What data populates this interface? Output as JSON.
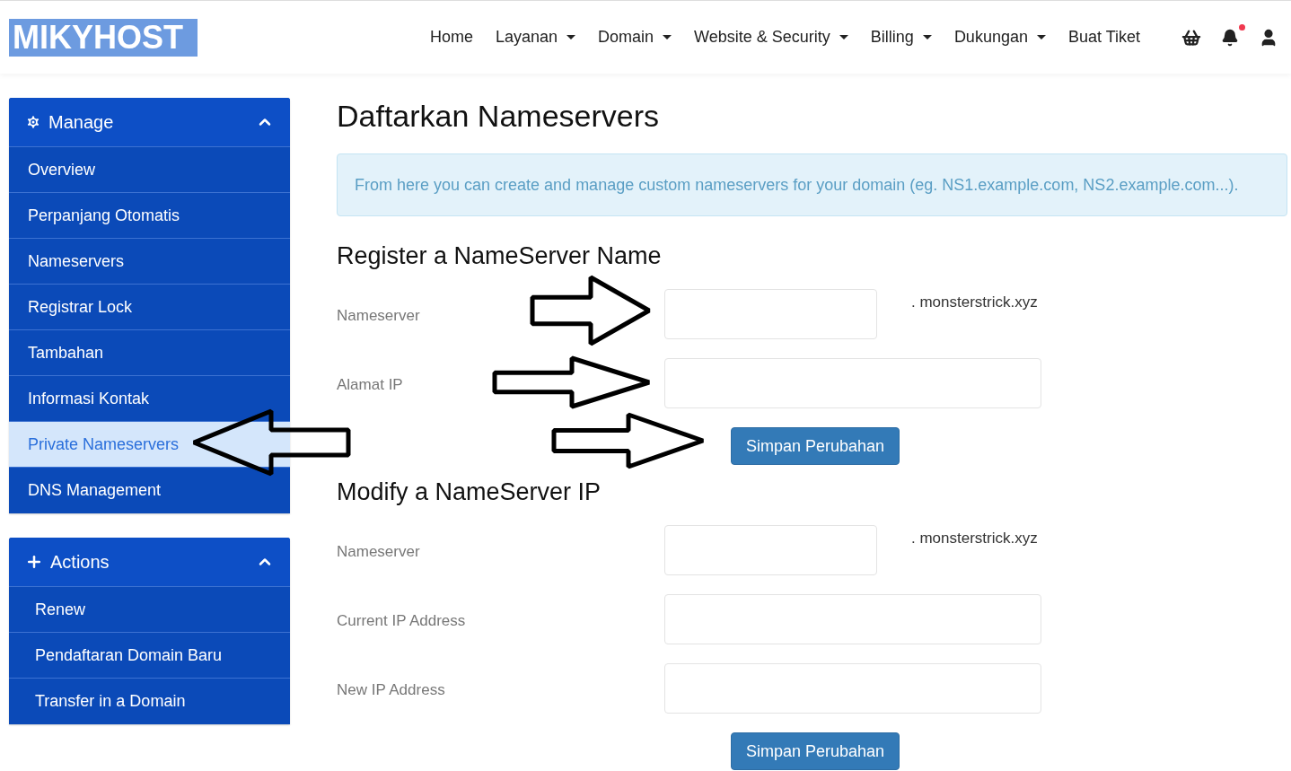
{
  "logo": "MIKYHOST",
  "nav": [
    {
      "label": "Home",
      "dropdown": false
    },
    {
      "label": "Layanan",
      "dropdown": true
    },
    {
      "label": "Domain",
      "dropdown": true
    },
    {
      "label": "Website & Security",
      "dropdown": true
    },
    {
      "label": "Billing",
      "dropdown": true
    },
    {
      "label": "Dukungan",
      "dropdown": true
    },
    {
      "label": "Buat Tiket",
      "dropdown": false
    }
  ],
  "notifications": {
    "unread": true
  },
  "sidebar": [
    {
      "title": "Manage",
      "expanded": true,
      "items": [
        {
          "label": "Overview",
          "selected": false
        },
        {
          "label": "Perpanjang Otomatis",
          "selected": false
        },
        {
          "label": "Nameservers",
          "selected": false
        },
        {
          "label": "Registrar Lock",
          "selected": false
        },
        {
          "label": "Tambahan",
          "selected": false
        },
        {
          "label": "Informasi Kontak",
          "selected": false
        },
        {
          "label": "Private Nameservers",
          "selected": true
        },
        {
          "label": "DNS Management",
          "selected": false
        }
      ]
    },
    {
      "title": "Actions",
      "expanded": true,
      "items": [
        {
          "label": "Renew",
          "selected": false
        },
        {
          "label": "Pendaftaran Domain Baru",
          "selected": false
        },
        {
          "label": "Transfer in a Domain",
          "selected": false
        }
      ]
    }
  ],
  "title": "Daftarkan Nameservers",
  "info": "From here you can create and manage custom nameservers for your domain (eg. NS1.example.com, NS2.example.com...).",
  "sections": [
    {
      "heading": "Register a NameServer Name",
      "button": "Simpan Perubahan",
      "fields": [
        {
          "label": "Nameserver",
          "kind": "short",
          "suffix": ". monsterstrick.xyz"
        },
        {
          "label": "Alamat IP",
          "kind": "wide"
        }
      ]
    },
    {
      "heading": "Modify a NameServer IP",
      "button": "Simpan Perubahan",
      "fields": [
        {
          "label": "Nameserver",
          "kind": "short",
          "suffix": ". monsterstrick.xyz"
        },
        {
          "label": "Current IP Address",
          "kind": "wide"
        },
        {
          "label": "New IP Address",
          "kind": "wide"
        }
      ]
    }
  ]
}
